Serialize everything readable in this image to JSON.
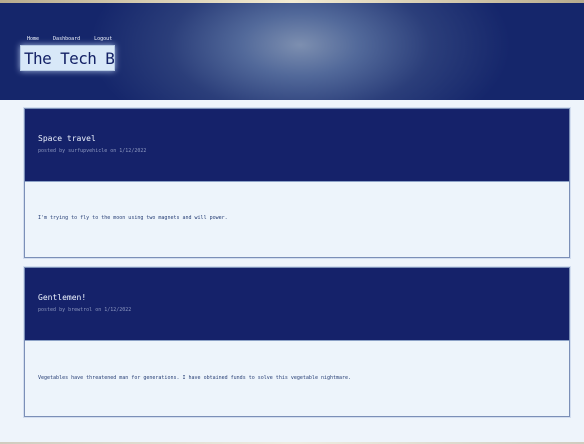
{
  "nav": {
    "items": [
      "Home",
      "Dashboard",
      "Logout"
    ]
  },
  "site": {
    "title": "The Tech Blog"
  },
  "posts": [
    {
      "title": "Space travel",
      "meta": "posted by surfupvehicle on 1/12/2022",
      "body": "I'm trying to fly to the moon using two magnets and will power."
    },
    {
      "title": "Gentlemen!",
      "meta": "posted by brewtrol on 1/12/2022",
      "body": "Vegetables have threatened man for generations. I have obtained funds to solve this vegetable nightmare."
    }
  ],
  "colors": {
    "header_navy": "#15266b",
    "post_header_navy": "#15226a",
    "page_background": "#eef4fb",
    "brand_background": "#d8e8f8",
    "body_text": "#253d74"
  }
}
